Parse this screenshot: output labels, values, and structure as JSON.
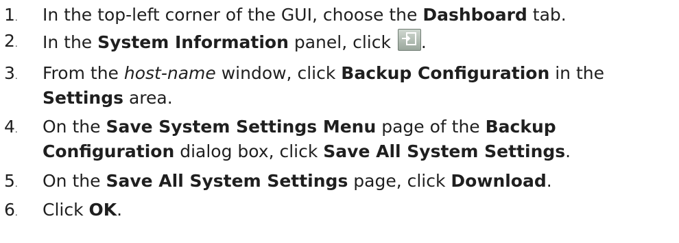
{
  "steps": [
    {
      "num": "1",
      "t1": "In the top-left corner of the GUI, choose the ",
      "b1": "Dashboard",
      "t2": " tab."
    },
    {
      "num": "2",
      "t1": "In the ",
      "b1": "System Information",
      "t2": " panel, click ",
      "t3": ".",
      "icon": "import-config-icon"
    },
    {
      "num": "3",
      "t1": "From the ",
      "i1": "host-name",
      "t2": " window, click ",
      "b1": "Backup Configuration",
      "t3": " in the ",
      "b2": "Settings",
      "t4": " area."
    },
    {
      "num": "4",
      "t1": "On the ",
      "b1": "Save System Settings Menu",
      "t2": " page of the ",
      "b2": "Backup Configuration",
      "t3": " dialog box, click ",
      "b3": "Save All System Settings",
      "t4": "."
    },
    {
      "num": "5",
      "t1": "On the ",
      "b1": "Save All System Settings",
      "t2": " page, click ",
      "b2": "Download",
      "t3": "."
    },
    {
      "num": "6",
      "t1": "Click ",
      "b1": "OK",
      "t2": "."
    }
  ],
  "dot": "."
}
